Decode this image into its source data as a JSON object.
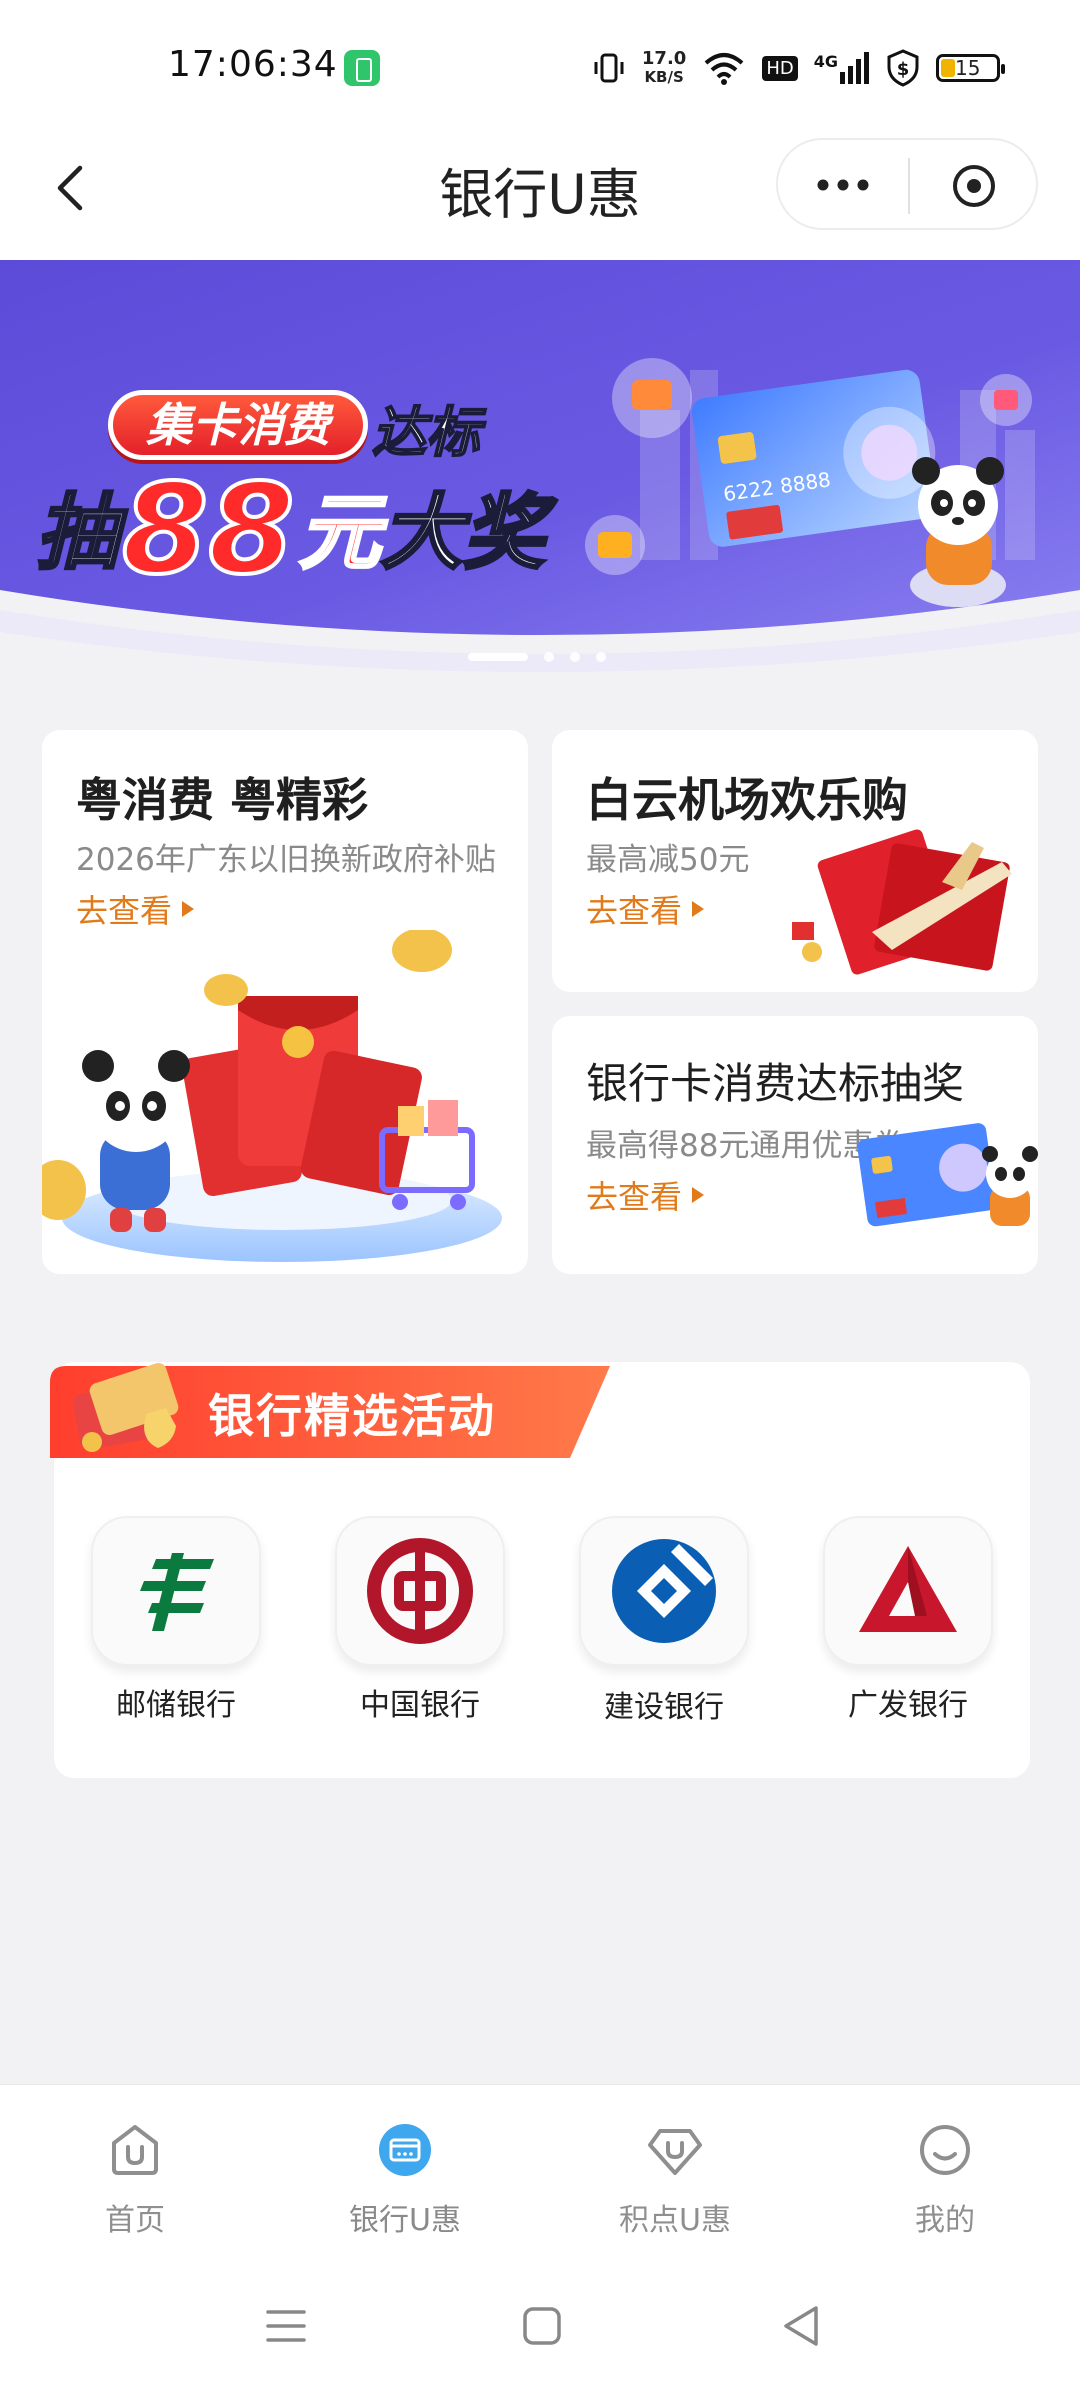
{
  "status_bar": {
    "time": "17:06:34",
    "net_speed_value": "17.0",
    "net_speed_unit": "KB/S",
    "hd": "HD",
    "network": "4G",
    "battery": "15"
  },
  "navbar": {
    "title": "银行U惠"
  },
  "banner": {
    "tag": "集卡消费",
    "tag_suffix": "达标",
    "line_prefix": "抽",
    "line_number": "88",
    "line_unit": "元",
    "line_suffix": "大奖",
    "card_number": "6222 8888",
    "slide_count": 4,
    "active_slide": 1
  },
  "cards": {
    "big": {
      "title": "粤消费 粤精彩",
      "subtitle": "2026年广东以旧换新政府补贴",
      "link": "去查看"
    },
    "right_top": {
      "title": "白云机场欢乐购",
      "subtitle": "最高减50元",
      "link": "去查看"
    },
    "right_bottom": {
      "title": "银行卡消费达标抽奖",
      "subtitle": "最高得88元通用优惠券",
      "link": "去查看"
    }
  },
  "bank_section": {
    "title": "银行精选活动",
    "banks": [
      {
        "name": "邮储银行",
        "icon": "psbc-logo-icon",
        "color": "#0b7a3e"
      },
      {
        "name": "中国银行",
        "icon": "boc-logo-icon",
        "color": "#b1162a"
      },
      {
        "name": "建设银行",
        "icon": "ccb-logo-icon",
        "color": "#0a5fb4"
      },
      {
        "name": "广发银行",
        "icon": "cgb-logo-icon",
        "color": "#c8172c"
      }
    ]
  },
  "tabbar": {
    "items": [
      {
        "label": "首页",
        "icon": "home-u-icon"
      },
      {
        "label": "银行U惠",
        "icon": "bank-card-icon",
        "active": true
      },
      {
        "label": "积点U惠",
        "icon": "points-gem-icon"
      },
      {
        "label": "我的",
        "icon": "smiley-icon"
      }
    ]
  },
  "colors": {
    "accent_orange": "#e07a1a",
    "active_tab_blue": "#3ea7ee",
    "banner_purple": "#5a4ed6"
  }
}
